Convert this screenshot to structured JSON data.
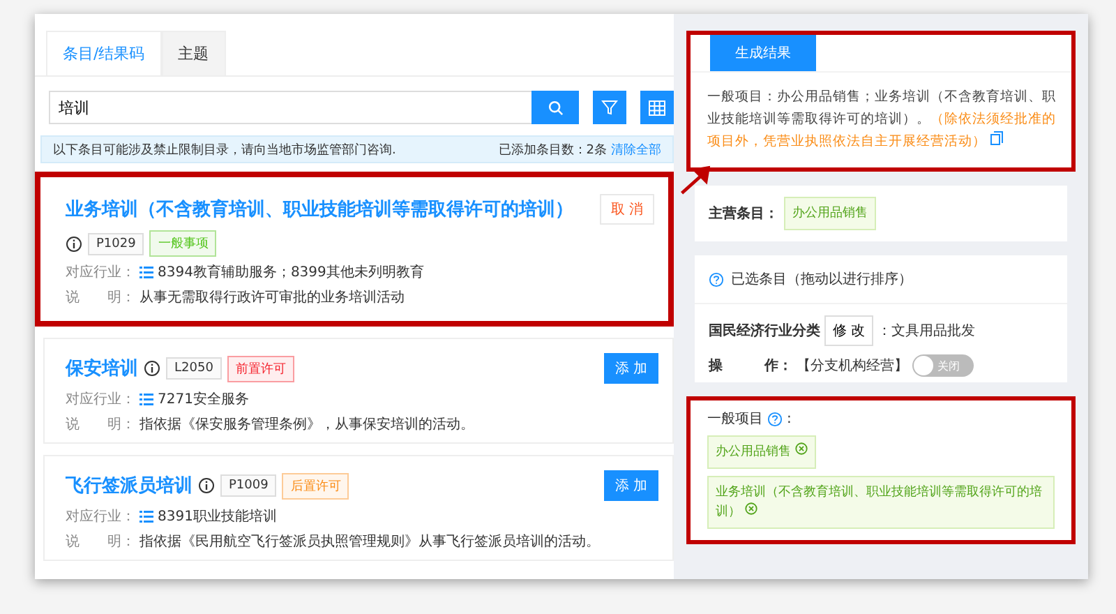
{
  "tabs": [
    {
      "label": "条目/结果码",
      "selected": true
    },
    {
      "label": "主题",
      "selected": false
    }
  ],
  "search": {
    "value": "培训"
  },
  "notice": {
    "text": "以下条目可能涉及禁止限制目录，请向当地市场监管部门咨询.",
    "count": "已添加条目数：2条",
    "clear": "清除全部"
  },
  "results": [
    {
      "title": "业务培训（不含教育培训、职业技能培训等需取得许可的培训）",
      "code": "P1029",
      "tag": {
        "label": "一般事项",
        "color": "#52c41a"
      },
      "action": "取 消",
      "added": true,
      "highlighted": true,
      "industry_label": "对应行业：",
      "industry": "8394教育辅助服务；8399其他未列明教育",
      "desc_label": "说　　明：",
      "desc": "从事无需取得行政许可审批的业务培训活动"
    },
    {
      "title": "保安培训",
      "code": "L2050",
      "tag": {
        "label": "前置许可",
        "color": "#f5222d"
      },
      "action": "添 加",
      "added": false,
      "highlighted": false,
      "industry_label": "对应行业：",
      "industry": "7271安全服务",
      "desc_label": "说　　明：",
      "desc": "指依据《保安服务管理条例》，从事保安培训的活动。"
    },
    {
      "title": "飞行签派员培训",
      "code": "P1009",
      "tag": {
        "label": "后置许可",
        "color": "#fa8c16"
      },
      "action": "添 加",
      "added": false,
      "highlighted": false,
      "industry_label": "对应行业：",
      "industry": "8391职业技能培训",
      "desc_label": "说　　明：",
      "desc": "指依据《民用航空飞行签派员执照管理规则》从事飞行签派员培训的活动。"
    }
  ],
  "result_panel": {
    "button": "生成结果",
    "text": "一般项目：办公用品销售；业务培训（不含教育培训、职业技能培训等需取得许可的培训）。",
    "note": "（除依法须经批准的项目外，凭营业执照依法自主开展经营活动）"
  },
  "main_item": {
    "label": "主营条目：",
    "tag": "办公用品销售"
  },
  "selected": {
    "title": "已选条目（拖动以进行排序）",
    "industry_label": "国民经济行业分类",
    "modify": "修 改",
    "industry_value": "：文具用品批发",
    "op_label": "操　　　作：",
    "op_value": "【分支机构经营】",
    "switch": {
      "on": false,
      "label": "关闭"
    },
    "general_label": "一般项目",
    "general_colon": ":",
    "items": [
      {
        "label": "办公用品销售"
      },
      {
        "label": "业务培训（不含教育培训、职业技能培训等需取得许可的培训）"
      }
    ]
  }
}
